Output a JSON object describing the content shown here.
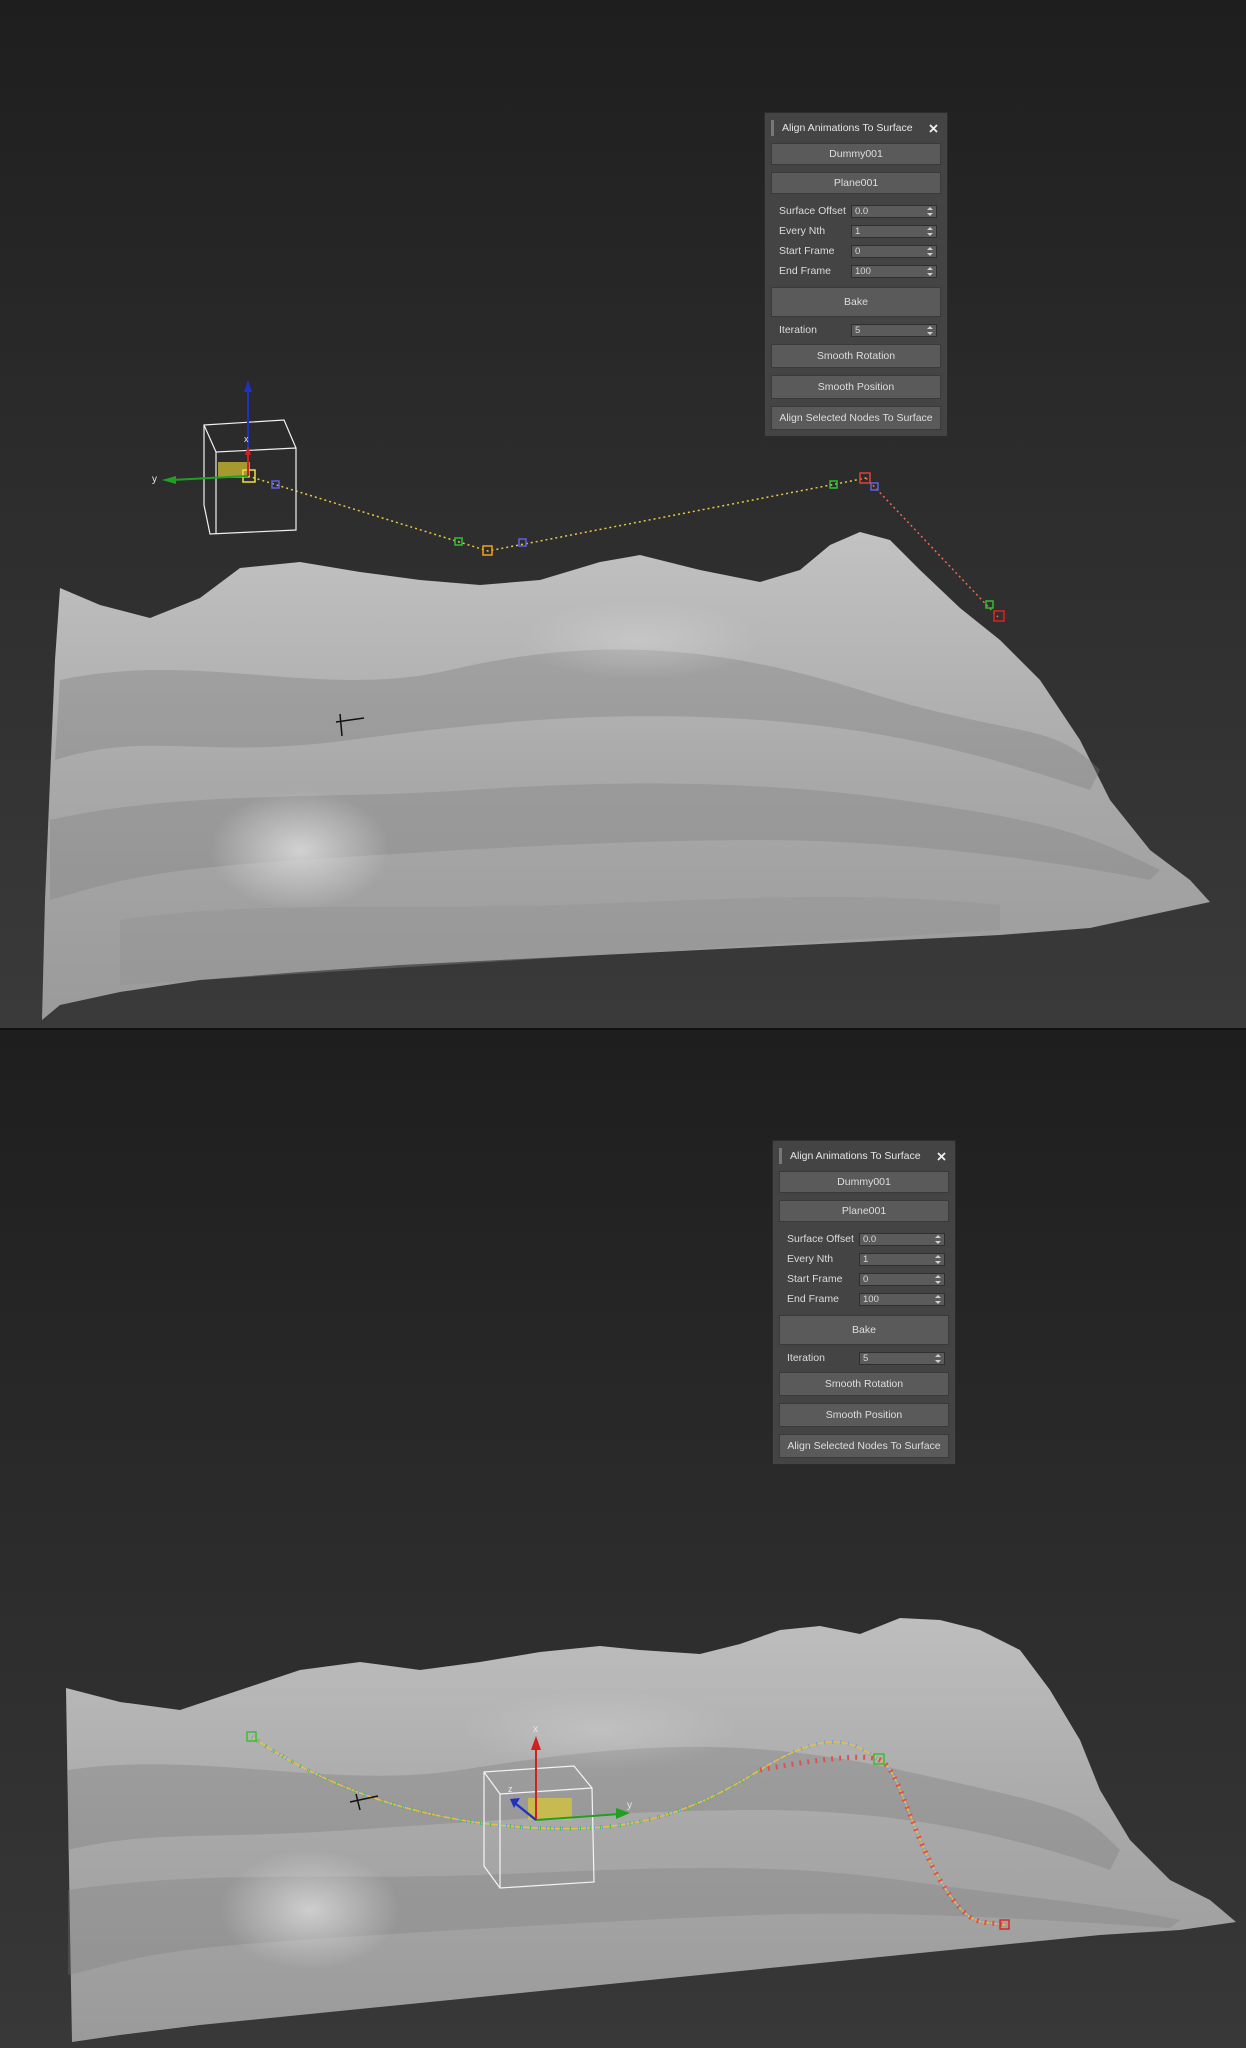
{
  "panel": {
    "title": "Align Animations To Surface",
    "source_button": "Dummy001",
    "target_button": "Plane001",
    "fields": [
      {
        "label": "Surface Offset",
        "value": "0.0"
      },
      {
        "label": "Every Nth",
        "value": "1"
      },
      {
        "label": "Start Frame",
        "value": "0"
      },
      {
        "label": "End Frame",
        "value": "100"
      }
    ],
    "bake_button": "Bake",
    "iteration": {
      "label": "Iteration",
      "value": "5"
    },
    "smooth_rotation_button": "Smooth Rotation",
    "smooth_position_button": "Smooth Position",
    "align_nodes_button": "Align Selected Nodes To Surface"
  },
  "gizmo": {
    "axis_x": "x",
    "axis_y": "y",
    "axis_z": "z"
  },
  "colors": {
    "viewport_bg": "#2a2a2a",
    "terrain": "#a6a6a6",
    "panel_bg": "#444444",
    "button_bg": "#5a5a5a",
    "path_yellow": "#e8c840",
    "path_red": "#e05050",
    "axis_x": "#d02020",
    "axis_y": "#20a020",
    "axis_z": "#2030c0"
  }
}
